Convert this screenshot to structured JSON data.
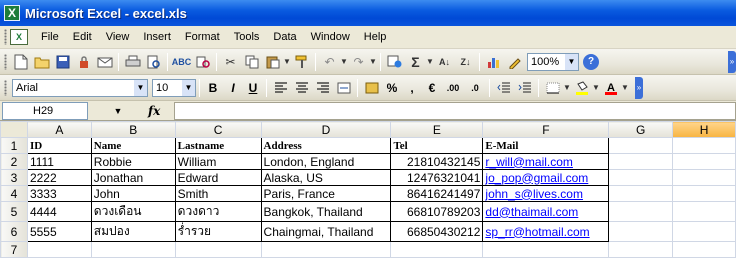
{
  "window": {
    "title": "Microsoft Excel - excel.xls",
    "app_icon": "excel-icon"
  },
  "menu": [
    "File",
    "Edit",
    "View",
    "Insert",
    "Format",
    "Tools",
    "Data",
    "Window",
    "Help"
  ],
  "toolbar": {
    "zoom": "100%"
  },
  "format_toolbar": {
    "font": "Arial",
    "size": "10",
    "bold": "B",
    "italic": "I",
    "underline": "U",
    "percent": "%",
    "comma": ",",
    "currency": "€",
    "inc_decimal": ".00",
    "dec_decimal": ".0"
  },
  "formula_bar": {
    "name_box": "H29",
    "fx": "fx",
    "formula": ""
  },
  "sheet": {
    "columns": [
      "A",
      "B",
      "C",
      "D",
      "E",
      "F",
      "G",
      "H"
    ],
    "selected_column": "H",
    "row_numbers": [
      "1",
      "2",
      "3",
      "4",
      "5",
      "6",
      "7"
    ],
    "headers": [
      "ID",
      "Name",
      "Lastname",
      "Address",
      "Tel",
      "E-Mail"
    ],
    "rows": [
      [
        "1111",
        "Robbie",
        "William",
        "London, England",
        "21810432145",
        "r_will@mail.com"
      ],
      [
        "2222",
        "Jonathan",
        "Edward",
        "Alaska, US",
        "12476321041",
        "jo_pop@gmail.com"
      ],
      [
        "3333",
        "John",
        "Smith",
        "Paris, France",
        "86416241497",
        "john_s@lives.com"
      ],
      [
        "4444",
        "ดวงเดือน",
        "ดวงดาว",
        "Bangkok, Thailand",
        "66810789203",
        "dd@thaimail.com"
      ],
      [
        "5555",
        "สมปอง",
        "ร่ำรวย",
        "Chaingmai, Thailand",
        "66850430212",
        "sp_rr@hotmail.com"
      ]
    ]
  }
}
